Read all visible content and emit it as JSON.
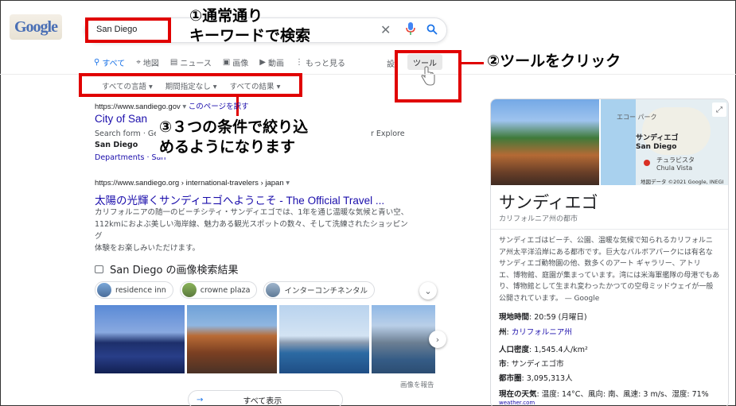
{
  "logo": "Google",
  "search": {
    "query": "San Diego"
  },
  "tabs": [
    {
      "icon": "search-icon",
      "label": "すべて"
    },
    {
      "icon": "map-pin-icon",
      "label": "地図"
    },
    {
      "icon": "news-icon",
      "label": "ニュース"
    },
    {
      "icon": "image-icon",
      "label": "画像"
    },
    {
      "icon": "video-icon",
      "label": "動画"
    },
    {
      "icon": "more-icon",
      "label": "もっと見る"
    }
  ],
  "settings_label": "設",
  "tools_label": "ツール",
  "filters": [
    "すべての言語",
    "期間指定なし",
    "すべての結果"
  ],
  "annotations": {
    "step1_line1": "①通常通り",
    "step1_line2": "キーワードで検索",
    "step2": "②ツールをクリック",
    "step3_line1": "③３つの条件で絞り込",
    "step3_line2": "めるようになります"
  },
  "result1": {
    "url": "https://www.sandiego.gov",
    "page_link": "このページを訳す",
    "title": "City of San",
    "snippet_start": "Search form · Ge",
    "snippet_end": "r Explore",
    "bold": "San Diego",
    "sublink": "Departments",
    "sublink_rest": "· San"
  },
  "result2": {
    "url": "https://www.sandiego.org › international-travelers › japan",
    "title": "太陽の光輝くサンディエゴへようこそ - The Official Travel ...",
    "snippet_lines": [
      "カリフォルニアの随一のビーチシティ・サンディエゴでは、1年を通じ温暖な気候と青い空、",
      "112kmにおよぶ美しい海岸線、魅力ある観光スポットの数々、そして洗練されたショッピング",
      "体験をお楽しみいただけます。"
    ]
  },
  "images": {
    "heading": "San Diego の画像検索結果",
    "chips": [
      "residence inn",
      "crowne plaza",
      "インターコンチネンタル"
    ],
    "report": "画像を報告",
    "show_all": "すべて表示"
  },
  "kp": {
    "map_labels": [
      "エコー パーク",
      "サンディエゴ",
      "San Diego",
      "チュラビスタ",
      "Chula Vista"
    ],
    "map_credit": "地図データ ©2021 Google, INEGI",
    "title": "サンディエゴ",
    "subtitle": "カリフォルニア州の都市",
    "description_lines": [
      "サンディエゴはビーチ、公園、温暖な気候で知られるカリフォルニ",
      "ア州太平洋沿岸にある都市です。巨大なバルボアパークには有名な",
      "サンディエゴ動物園の他、数多くのアート ギャラリー、アトリ",
      "エ、博物館、庭園が集まっています。湾には米海軍艦隊の母港でもあ",
      "り、博物館として生まれ変わったかつての空母ミッドウェイが一般",
      "公開されています。 — Google"
    ],
    "facts": [
      {
        "label": "現地時間",
        "value": "20:59 (月曜日)"
      },
      {
        "label": "州",
        "value": "カリフォルニア州"
      },
      {
        "label": "人口密度",
        "value": "1,545.4人/km²"
      },
      {
        "label": "市",
        "value": "サンディエゴ市"
      },
      {
        "label": "都市圏",
        "value": "3,095,313人"
      },
      {
        "label": "現在の天気",
        "value": "温度: 14°C、風向: 南、風速: 3 m/s、湿度: 71%"
      }
    ],
    "weather_source": "weather.com"
  }
}
